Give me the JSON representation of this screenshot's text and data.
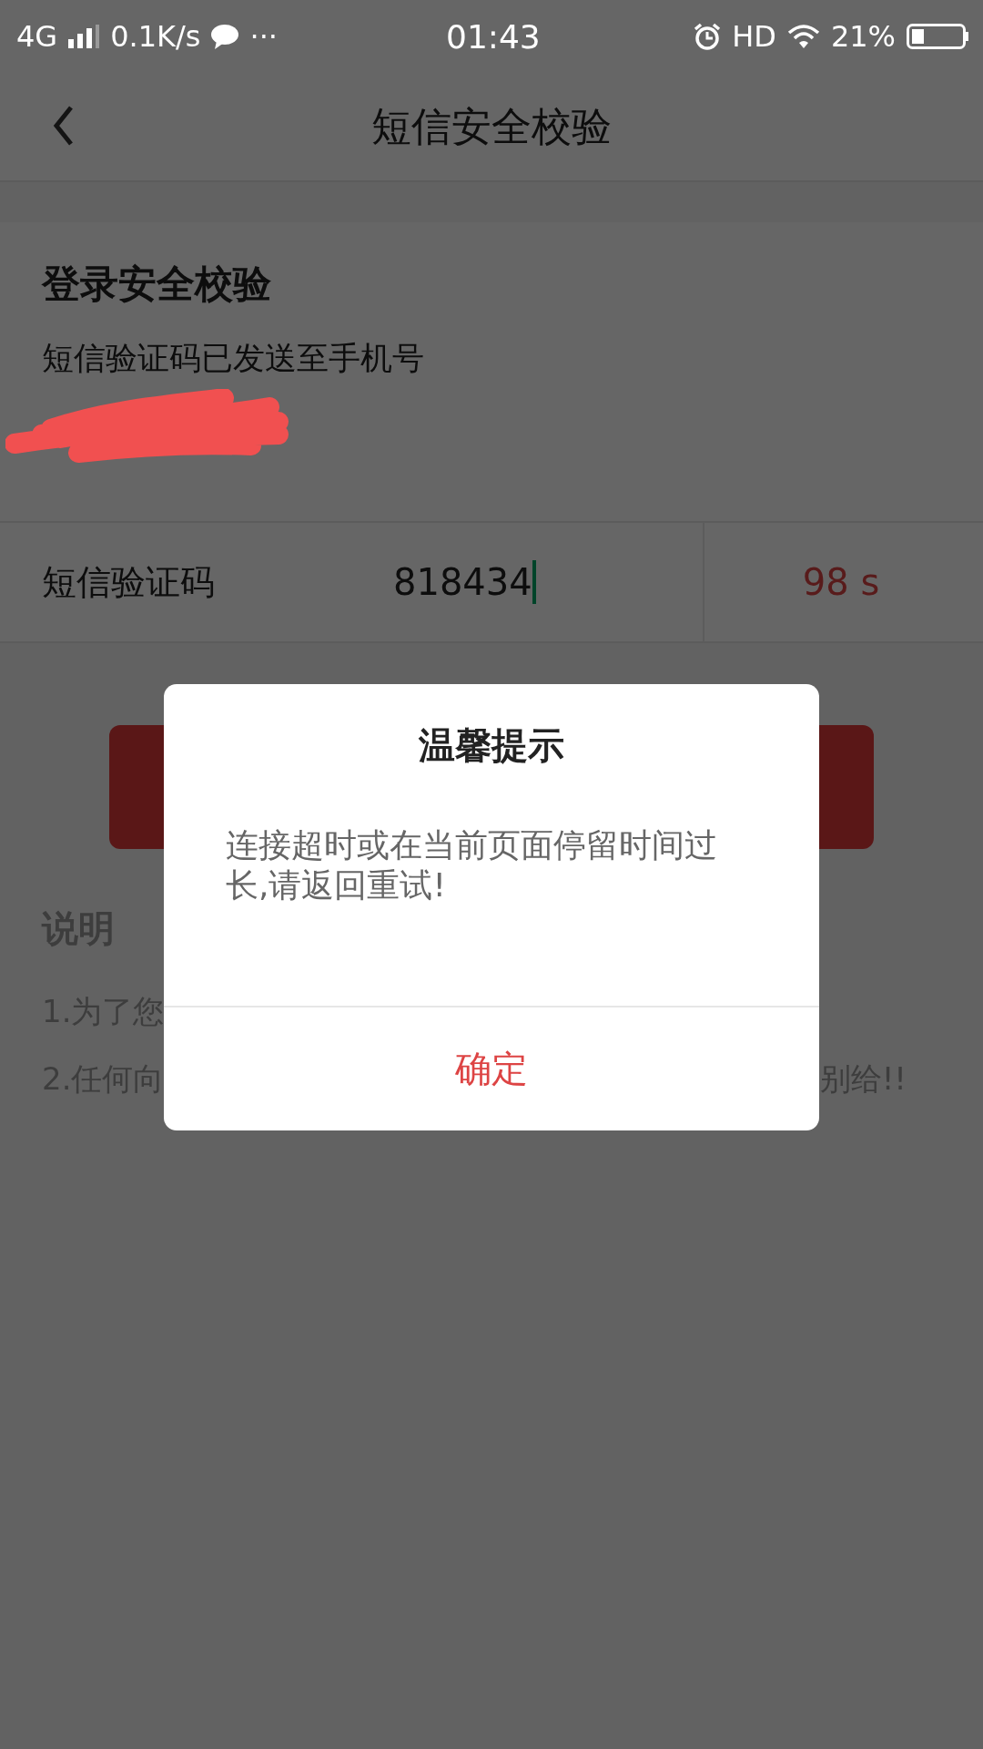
{
  "status_bar": {
    "network": "4G",
    "speed": "0.1K/s",
    "more": "···",
    "time": "01:43",
    "hd": "HD",
    "battery": "21%"
  },
  "nav": {
    "title": "短信安全校验"
  },
  "card": {
    "title": "登录安全校验",
    "subtitle": "短信验证码已发送至手机号"
  },
  "code_row": {
    "label": "短信验证码",
    "value": "818434",
    "countdown": "98 s"
  },
  "notes": {
    "title": "说明",
    "lines": [
      {
        "start": "1.为了您"
      },
      {
        "start": "2.任何向",
        "end": "别给!!"
      }
    ]
  },
  "dialog": {
    "title": "温馨提示",
    "message": "连接超时或在当前页面停留时间过长,请返回重试!",
    "button": "确定"
  }
}
